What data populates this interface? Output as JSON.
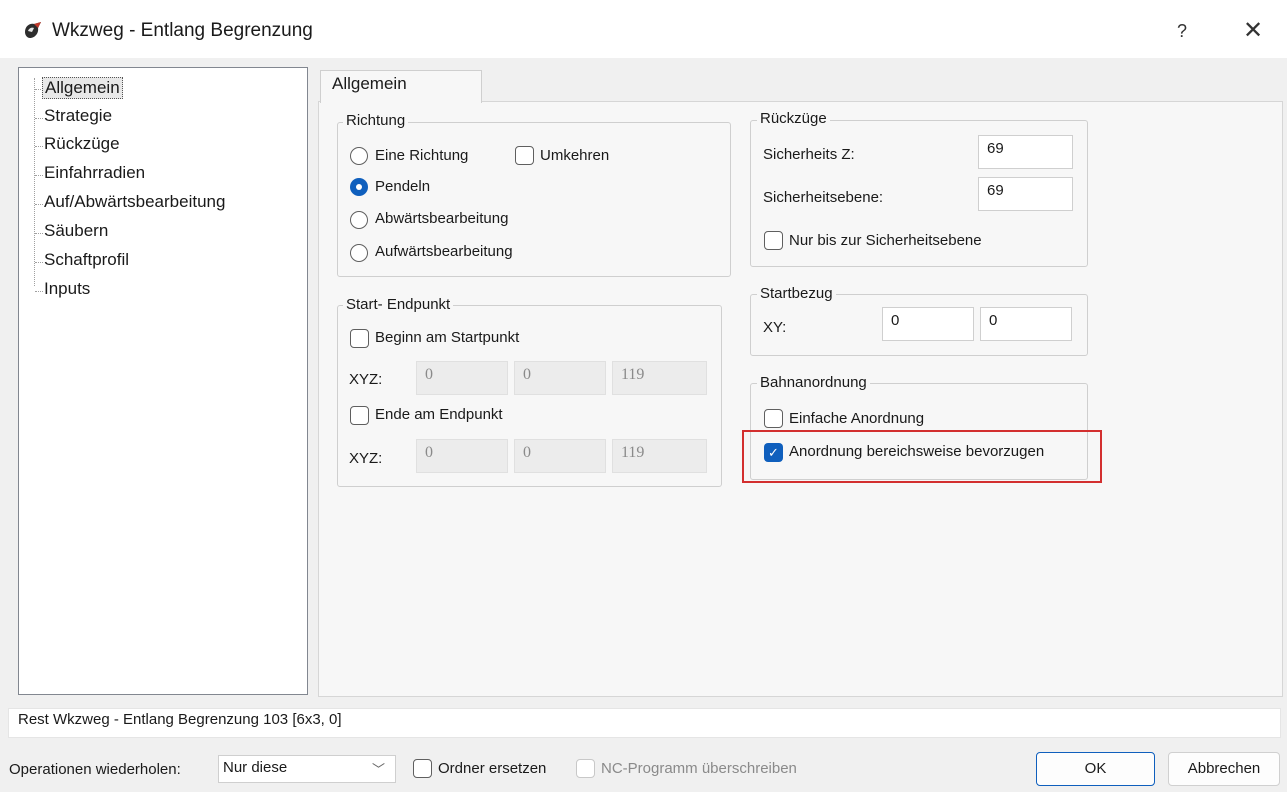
{
  "window": {
    "title": "Wkzweg - Entlang Begrenzung",
    "help_label": "?",
    "close_label": "✕"
  },
  "tree": {
    "items": [
      "Allgemein",
      "Strategie",
      "Rückzüge",
      "Einfahrradien",
      "Auf/Abwärtsbearbeitung",
      "Säubern",
      "Schaftprofil",
      "Inputs"
    ],
    "selected": "Allgemein"
  },
  "tab": {
    "label": "Allgemein"
  },
  "richtung": {
    "title": "Richtung",
    "options": [
      {
        "label": "Eine Richtung",
        "checked": false
      },
      {
        "label": "Pendeln",
        "checked": true
      },
      {
        "label": "Abwärtsbearbeitung",
        "checked": false
      },
      {
        "label": "Aufwärtsbearbeitung",
        "checked": false
      }
    ],
    "umkehren_label": "Umkehren",
    "umkehren_checked": false
  },
  "start_end": {
    "title": "Start- Endpunkt",
    "begin_label": "Beginn am Startpunkt",
    "begin_checked": false,
    "xyz_label": "XYZ:",
    "start_xyz": [
      "0",
      "0",
      "119"
    ],
    "end_label": "Ende am Endpunkt",
    "end_checked": false,
    "end_xyz": [
      "0",
      "0",
      "119"
    ]
  },
  "rueckzuege": {
    "title": "Rückzüge",
    "sicherheits_z_label": "Sicherheits Z:",
    "sicherheits_z_value": "69",
    "sicherheitsebene_label": "Sicherheitsebene:",
    "sicherheitsebene_value": "69",
    "nur_bis_label": "Nur bis zur Sicherheitsebene",
    "nur_bis_checked": false
  },
  "startbezug": {
    "title": "Startbezug",
    "xy_label": "XY:",
    "x_value": "0",
    "y_value": "0"
  },
  "bahnanordnung": {
    "title": "Bahnanordnung",
    "einfache_label": "Einfache Anordnung",
    "einfache_checked": false,
    "bereichsweise_label": "Anordnung bereichsweise bevorzugen",
    "bereichsweise_checked": true
  },
  "status": {
    "text": "Rest Wkzweg - Entlang Begrenzung 103 [6x3, 0]"
  },
  "bottom": {
    "operationen_label": "Operationen wiederholen:",
    "operationen_value": "Nur diese",
    "ordner_label": "Ordner ersetzen",
    "ordner_checked": false,
    "nc_label": "NC-Programm überschreiben",
    "nc_checked": false,
    "ok_label": "OK",
    "cancel_label": "Abbrechen"
  },
  "colors": {
    "accent": "#0f5fbd",
    "highlight": "#d32f2f",
    "panel": "#f7f7f7",
    "background": "#f0f0f0"
  }
}
